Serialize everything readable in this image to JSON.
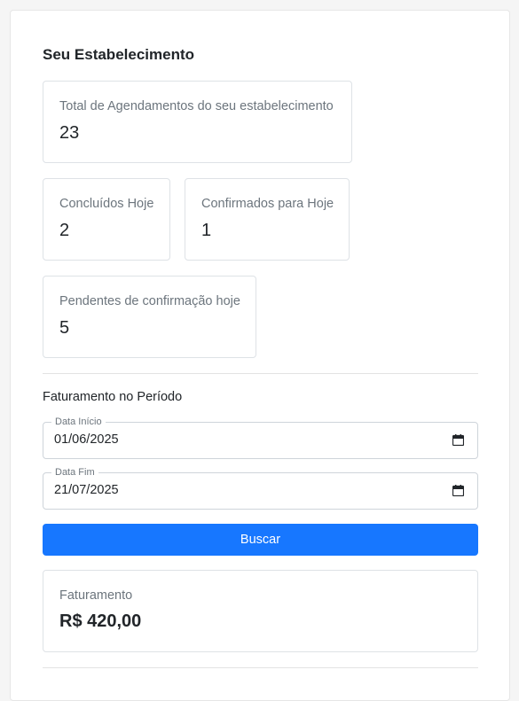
{
  "dashboard": {
    "title": "Seu Estabelecimento",
    "stats": {
      "total": {
        "label": "Total de Agendamentos do seu estabelecimento",
        "value": "23"
      },
      "completed_today": {
        "label": "Concluídos Hoje",
        "value": "2"
      },
      "confirmed_today": {
        "label": "Confirmados para Hoje",
        "value": "1"
      },
      "pending_today": {
        "label": "Pendentes de confirmação hoje",
        "value": "5"
      }
    }
  },
  "revenue_filter": {
    "title": "Faturamento no Período",
    "start_date": {
      "label": "Data Início",
      "value": "01/06/2025",
      "icon": "calendar-icon"
    },
    "end_date": {
      "label": "Data Fim",
      "value": "21/07/2025",
      "icon": "calendar-icon"
    },
    "search_button": "Buscar",
    "button_color": "#1777ff"
  },
  "revenue_result": {
    "label": "Faturamento",
    "value": "R$ 420,00"
  }
}
